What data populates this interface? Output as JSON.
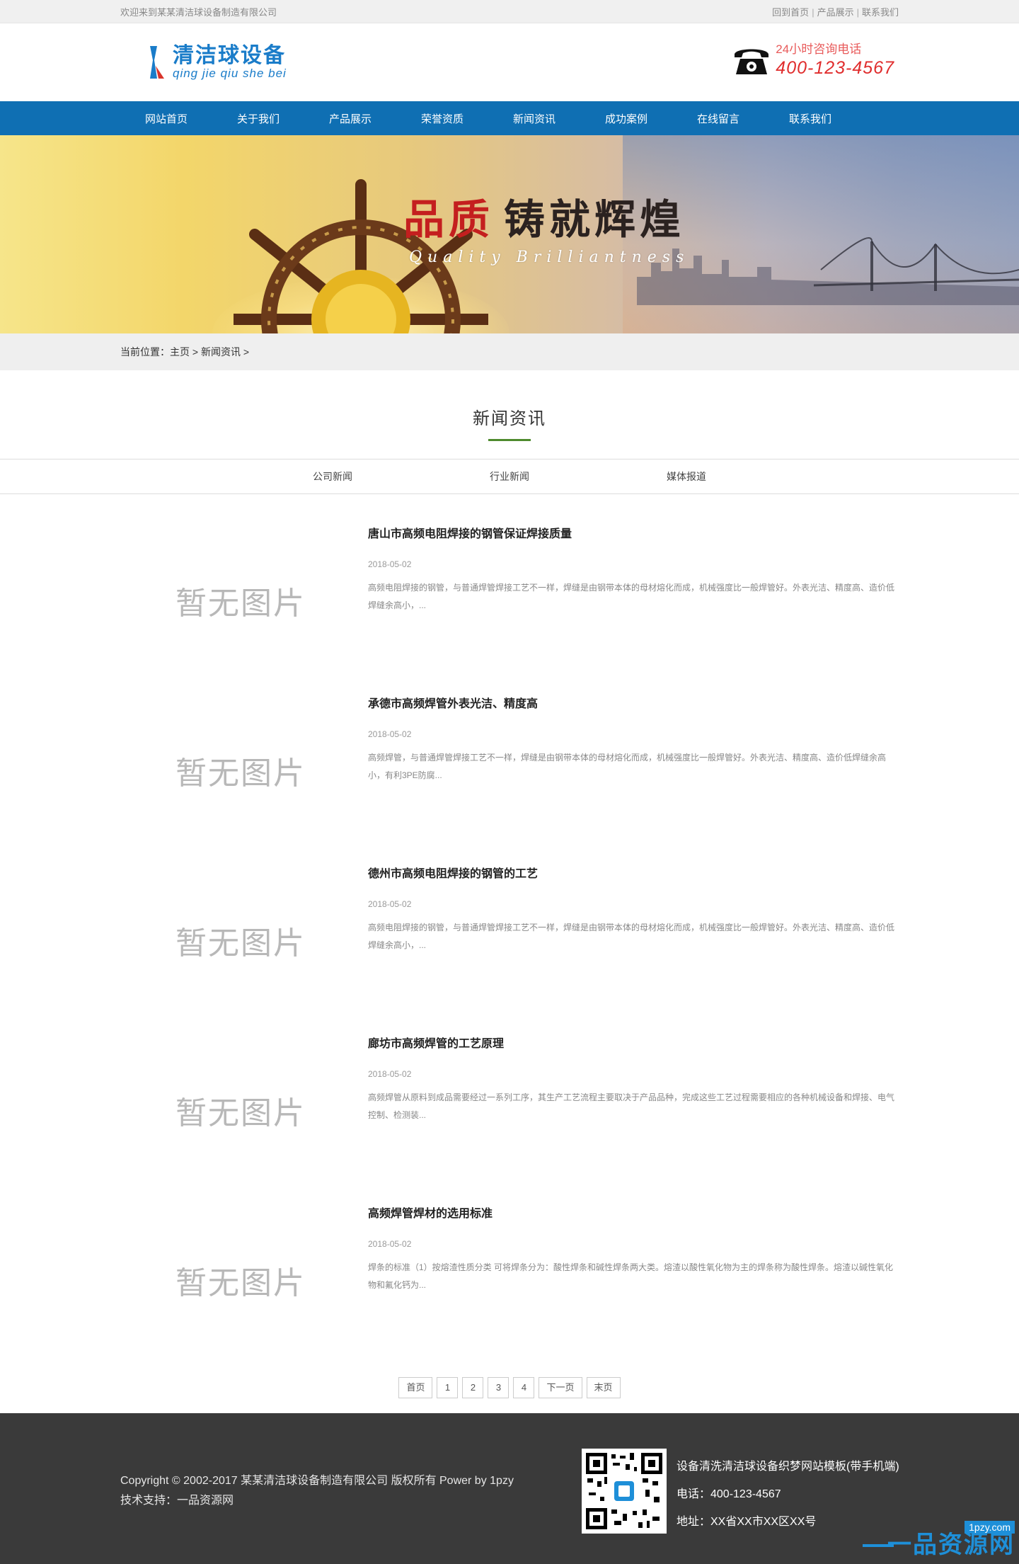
{
  "topbar": {
    "welcome": "欢迎来到某某清洁球设备制造有限公司",
    "links": [
      "回到首页",
      "产品展示",
      "联系我们"
    ]
  },
  "header": {
    "logo_cn": "清洁球设备",
    "logo_pinyin": "qing jie qiu she bei",
    "phone_label": "24小时咨询电话",
    "phone_number": "400-123-4567"
  },
  "nav": {
    "items": [
      "网站首页",
      "关于我们",
      "产品展示",
      "荣誉资质",
      "新闻资讯",
      "成功案例",
      "在线留言",
      "联系我们"
    ]
  },
  "banner": {
    "title_red": "品质",
    "title_dark": "铸就辉煌",
    "subtitle": "Quality Brilliantness"
  },
  "breadcrumb": {
    "prefix": "当前位置：",
    "home": "主页",
    "sep": " > ",
    "current": "新闻资讯",
    "trail": " >"
  },
  "section": {
    "title": "新闻资讯"
  },
  "tabs": [
    "公司新闻",
    "行业新闻",
    "媒体报道"
  ],
  "news": {
    "placeholder": "暂无图片",
    "items": [
      {
        "title": "唐山市高频电阻焊接的钢管保证焊接质量",
        "date": "2018-05-02",
        "desc": "高频电阻焊接的钢管，与普通焊管焊接工艺不一样，焊缝是由钢带本体的母材熔化而成，机械强度比一般焊管好。外表光洁、精度高、造价低焊缝余高小，..."
      },
      {
        "title": "承德市高频焊管外表光洁、精度高",
        "date": "2018-05-02",
        "desc": "高频焊管，与普通焊管焊接工艺不一样，焊缝是由钢带本体的母材熔化而成，机械强度比一般焊管好。外表光洁、精度高、造价低焊缝余高小，有利3PE防腐..."
      },
      {
        "title": "德州市高频电阻焊接的钢管的工艺",
        "date": "2018-05-02",
        "desc": "高频电阻焊接的钢管，与普通焊管焊接工艺不一样，焊缝是由钢带本体的母材熔化而成，机械强度比一般焊管好。外表光洁、精度高、造价低焊缝余高小，..."
      },
      {
        "title": "廊坊市高频焊管的工艺原理",
        "date": "2018-05-02",
        "desc": "高频焊管从原料到成品需要经过一系列工序，其生产工艺流程主要取决于产品品种，完成这些工艺过程需要相应的各种机械设备和焊接、电气控制、检测装..."
      },
      {
        "title": "高频焊管焊材的选用标准",
        "date": "2018-05-02",
        "desc": "焊条的标准（1）按熔渣性质分类 可将焊条分为：酸性焊条和碱性焊条两大类。熔渣以酸性氧化物为主的焊条称为酸性焊条。熔渣以碱性氧化物和氟化钙为..."
      }
    ]
  },
  "pager": {
    "first": "首页",
    "pages": [
      "1",
      "2",
      "3",
      "4"
    ],
    "next": "下一页",
    "last": "末页"
  },
  "footer": {
    "copyright": "Copyright © 2002-2017 某某清洁球设备制造有限公司 版权所有 Power by 1pzy",
    "support": "技术支持：一品资源网",
    "site_name": "设备清洗清洁球设备织梦网站模板(带手机端)",
    "phone": "电话：400-123-4567",
    "address": "地址：XX省XX市XX区XX号",
    "corner_top": "1pzy.com",
    "corner_main": "一品资源网"
  },
  "colors": {
    "nav_bg": "#0f6fb3",
    "accent_green": "#4e8a2e",
    "phone_red": "#e02d2d",
    "footer_bg": "#3a3a3a"
  }
}
